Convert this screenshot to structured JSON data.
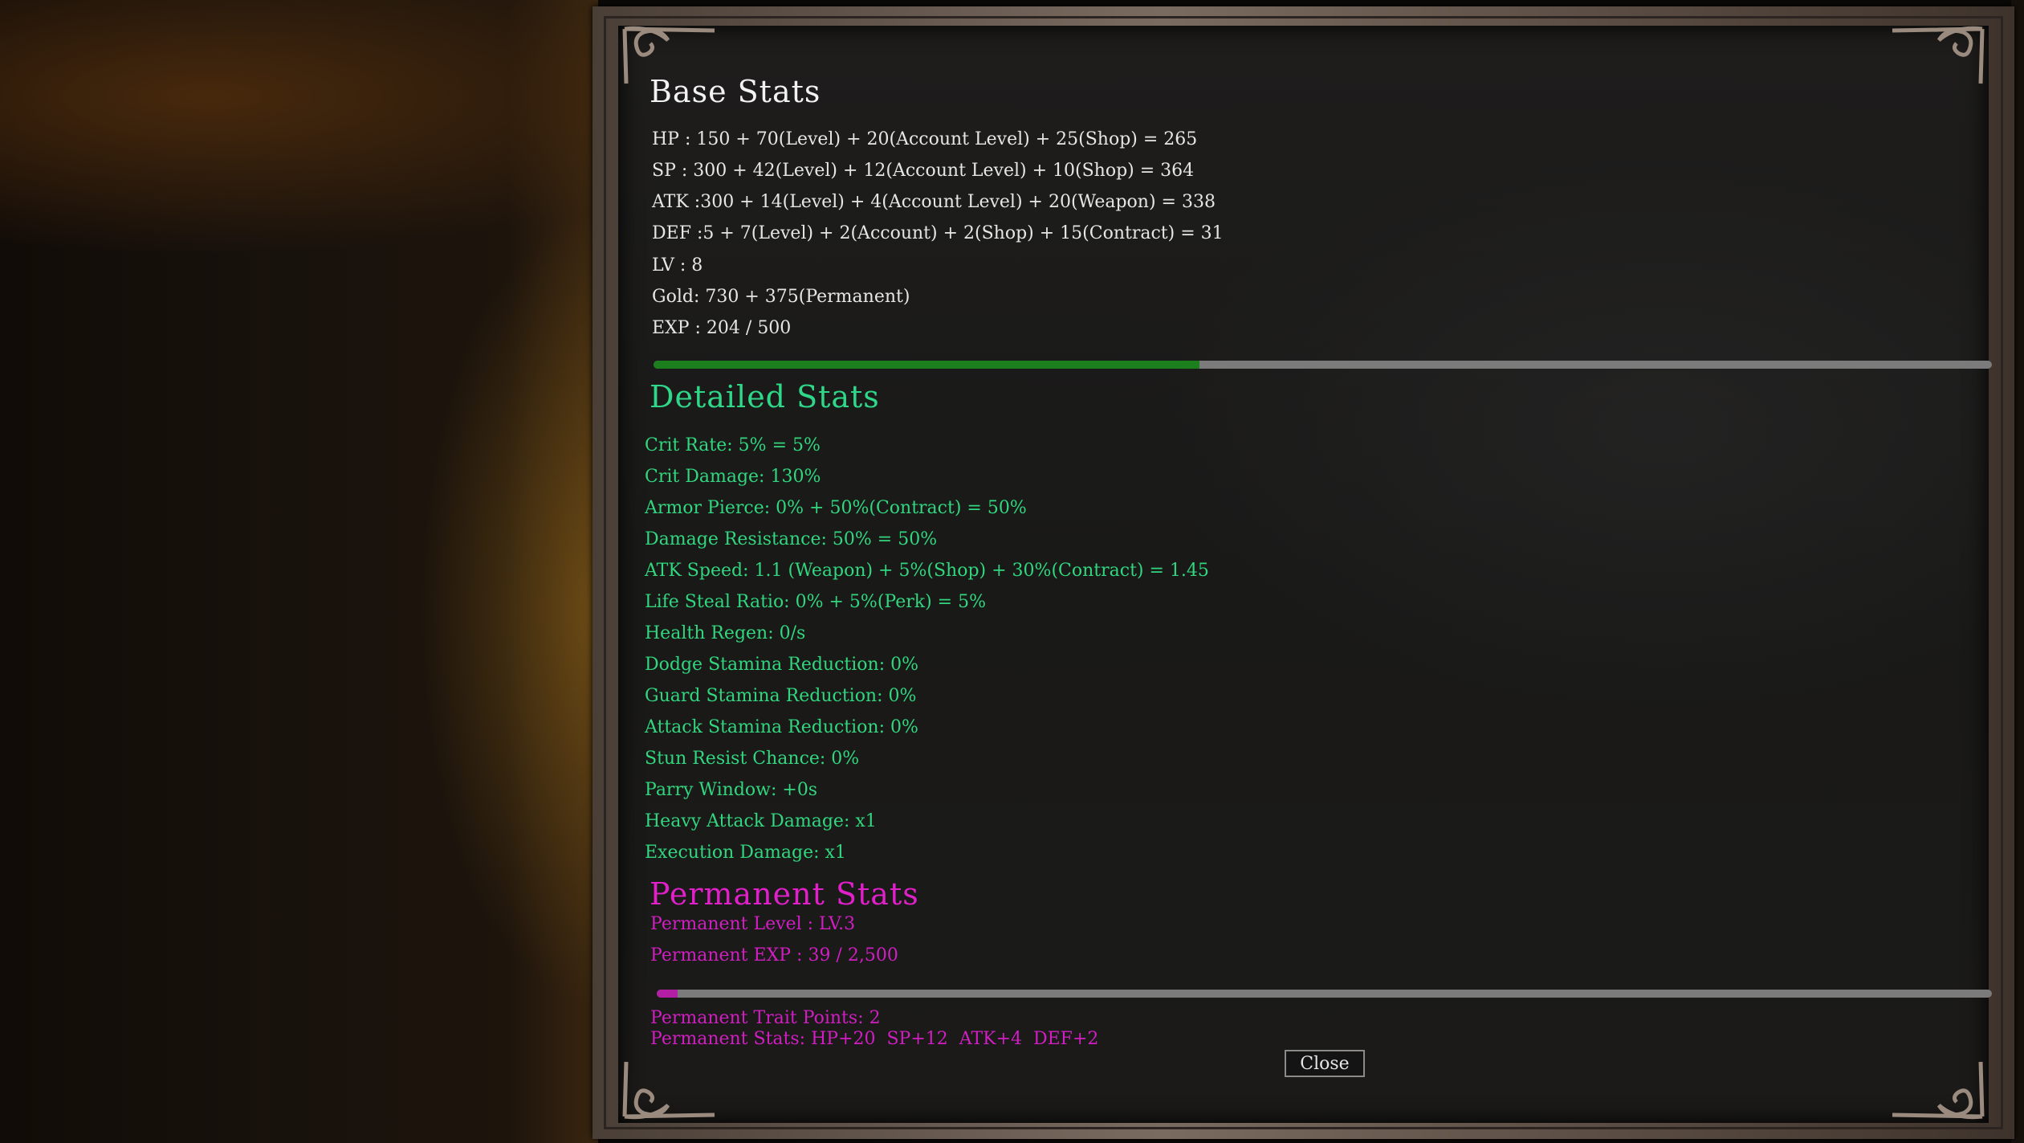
{
  "base_stats": {
    "title": "Base Stats",
    "lines": [
      "HP : 150 + 70(Level) + 20(Account Level) + 25(Shop) = 265",
      "SP : 300 + 42(Level) + 12(Account Level) + 10(Shop) = 364",
      "ATK :300 + 14(Level) + 4(Account Level) + 20(Weapon) = 338",
      "DEF :5 + 7(Level) + 2(Account) + 2(Shop) + 15(Contract) = 31",
      "LV : 8",
      "Gold: 730 + 375(Permanent)",
      "EXP : 204 / 500"
    ],
    "exp_current": 204,
    "exp_max": 500
  },
  "detailed_stats": {
    "title": "Detailed Stats",
    "lines": [
      "Crit Rate: 5% = 5%",
      "Crit Damage: 130%",
      "Armor Pierce: 0% + 50%(Contract) = 50%",
      "Damage Resistance: 50% = 50%",
      "ATK Speed: 1.1 (Weapon) + 5%(Shop) + 30%(Contract) = 1.45",
      "Life Steal Ratio: 0% + 5%(Perk) = 5%",
      "Health Regen: 0/s",
      "Dodge Stamina Reduction: 0%",
      "Guard Stamina Reduction: 0%",
      "Attack Stamina Reduction: 0%",
      "Stun Resist Chance: 0%",
      "Parry Window: +0s",
      "Heavy Attack Damage: x1",
      "Execution Damage: x1"
    ]
  },
  "permanent_stats": {
    "title": "Permanent Stats",
    "level": "Permanent Level : LV.3",
    "exp": "Permanent EXP : 39 / 2,500",
    "exp_current": 39,
    "exp_max": 2500,
    "trait_points": "Permanent Trait Points: 2",
    "stats": "Permanent Stats: HP+20  SP+12  ATK+4  DEF+2"
  },
  "close_label": "Close",
  "colors": {
    "base_text": "#e6e6e6",
    "detail_text": "#31d67e",
    "permanent_text": "#d11ec2",
    "exp_bar_fill": "#1b7f1d",
    "perm_bar_fill": "#b41ea4",
    "bar_track": "#7b7b7b"
  }
}
